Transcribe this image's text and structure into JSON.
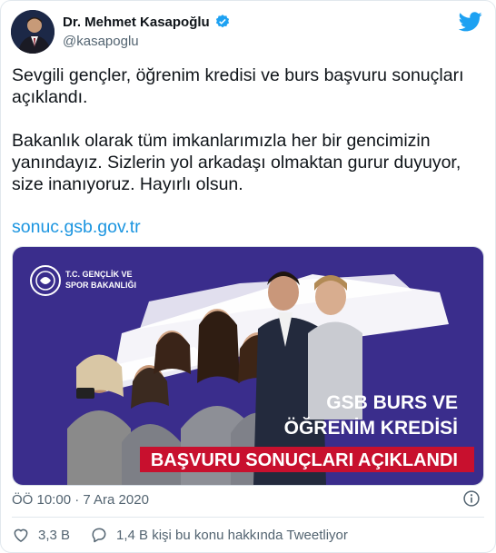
{
  "author": {
    "name": "Dr. Mehmet Kasapoğlu",
    "handle": "@kasapoglu",
    "verified": true
  },
  "tweet": {
    "paragraphs": [
      "Sevgili gençler, öğrenim kredisi ve burs başvuru sonuçları açıklandı.",
      "Bakanlık olarak tüm imkanlarımızla her bir gencimizin yanındayız. Sizlerin yol arkadaşı olmaktan gurur duyuyor, size inanıyoruz. Hayırlı olsun."
    ],
    "link": "sonuc.gsb.gov.tr"
  },
  "media": {
    "logo_line1": "T.C. GENÇLİK VE",
    "logo_line2": "SPOR BAKANLIĞI",
    "headline_line1": "GSB BURS VE",
    "headline_line2": "ÖĞRENİM KREDİSİ",
    "headline_line3": "BAŞVURU SONUÇLARI AÇIKLANDI"
  },
  "timestamp": "ÖÖ 10:00 · 7 Ara 2020",
  "actions": {
    "like_count": "3,3 B",
    "reply_text": "1,4 B kişi bu konu hakkında Tweetliyor"
  },
  "colors": {
    "link": "#1b95e0",
    "verified": "#1da1f2",
    "media_bg": "#3a2d8c",
    "banner_red": "#c8102e"
  }
}
